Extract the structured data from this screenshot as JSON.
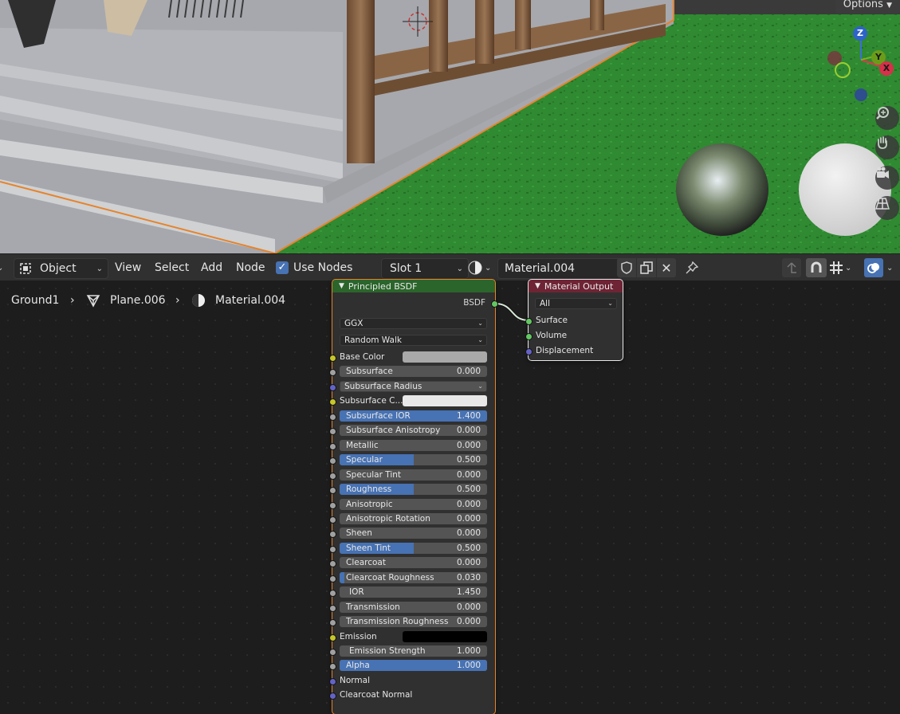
{
  "viewport": {
    "options_label": "Options",
    "gizmo": {
      "z": "Z",
      "y": "Y",
      "x": "X"
    }
  },
  "header": {
    "mode_icon": "object-mode-icon",
    "mode": "Object",
    "menus": [
      "View",
      "Select",
      "Add",
      "Node"
    ],
    "use_nodes_label": "Use Nodes",
    "use_nodes_checked": true,
    "slot": "Slot 1",
    "material_name": "Material.004"
  },
  "breadcrumb": {
    "items": [
      "Ground1",
      "Plane.006",
      "Material.004"
    ]
  },
  "principled": {
    "title": "Principled BSDF",
    "output": "BSDF",
    "distribution": "GGX",
    "subsurface_method": "Random Walk",
    "inputs": [
      {
        "label": "Base Color",
        "kind": "color",
        "color": "#a9a9a9",
        "socket": "#c7c729"
      },
      {
        "label": "Subsurface",
        "kind": "slider",
        "value": "0.000",
        "fill": 0,
        "socket": "#a1a1a1"
      },
      {
        "label": "Subsurface Radius",
        "kind": "select",
        "socket": "#6363c7"
      },
      {
        "label": "Subsurface C...",
        "kind": "color",
        "color": "#e8e8e8",
        "socket": "#c7c729"
      },
      {
        "label": "Subsurface IOR",
        "kind": "slider",
        "value": "1.400",
        "fill": 1,
        "socket": "#a1a1a1"
      },
      {
        "label": "Subsurface Anisotropy",
        "kind": "slider",
        "value": "0.000",
        "fill": 0,
        "socket": "#a1a1a1"
      },
      {
        "label": "Metallic",
        "kind": "slider",
        "value": "0.000",
        "fill": 0,
        "socket": "#a1a1a1"
      },
      {
        "label": "Specular",
        "kind": "slider",
        "value": "0.500",
        "fill": 0.5,
        "socket": "#a1a1a1"
      },
      {
        "label": "Specular Tint",
        "kind": "slider",
        "value": "0.000",
        "fill": 0,
        "socket": "#a1a1a1"
      },
      {
        "label": "Roughness",
        "kind": "slider",
        "value": "0.500",
        "fill": 0.5,
        "socket": "#a1a1a1"
      },
      {
        "label": "Anisotropic",
        "kind": "slider",
        "value": "0.000",
        "fill": 0,
        "socket": "#a1a1a1"
      },
      {
        "label": "Anisotropic Rotation",
        "kind": "slider",
        "value": "0.000",
        "fill": 0,
        "socket": "#a1a1a1"
      },
      {
        "label": "Sheen",
        "kind": "slider",
        "value": "0.000",
        "fill": 0,
        "socket": "#a1a1a1"
      },
      {
        "label": "Sheen Tint",
        "kind": "slider",
        "value": "0.500",
        "fill": 0.5,
        "socket": "#a1a1a1"
      },
      {
        "label": "Clearcoat",
        "kind": "slider",
        "value": "0.000",
        "fill": 0,
        "socket": "#a1a1a1"
      },
      {
        "label": "Clearcoat Roughness",
        "kind": "slider",
        "value": "0.030",
        "fill": 0.03,
        "socket": "#a1a1a1"
      },
      {
        "label": "IOR",
        "kind": "slider",
        "value": "1.450",
        "fill": 0,
        "socket": "#a1a1a1"
      },
      {
        "label": "Transmission",
        "kind": "slider",
        "value": "0.000",
        "fill": 0,
        "socket": "#a1a1a1"
      },
      {
        "label": "Transmission Roughness",
        "kind": "slider",
        "value": "0.000",
        "fill": 0,
        "socket": "#a1a1a1"
      },
      {
        "label": "Emission",
        "kind": "color",
        "color": "#000000",
        "socket": "#c7c729"
      },
      {
        "label": "Emission Strength",
        "kind": "slider",
        "value": "1.000",
        "fill": 0,
        "socket": "#a1a1a1"
      },
      {
        "label": "Alpha",
        "kind": "slider",
        "value": "1.000",
        "fill": 1,
        "socket": "#a1a1a1"
      },
      {
        "label": "Normal",
        "kind": "plain",
        "socket": "#6363c7"
      },
      {
        "label": "Clearcoat Normal",
        "kind": "plain",
        "socket": "#6363c7"
      }
    ]
  },
  "material_output": {
    "title": "Material Output",
    "target": "All",
    "inputs": [
      {
        "label": "Surface",
        "socket": "#63c763"
      },
      {
        "label": "Volume",
        "socket": "#63c763"
      },
      {
        "label": "Displacement",
        "socket": "#6363c7"
      }
    ]
  },
  "colors": {
    "accent": "#4772b3",
    "bsdf_header": "#2b652b",
    "output_header": "#6e2434",
    "selection": "#e6832b"
  }
}
